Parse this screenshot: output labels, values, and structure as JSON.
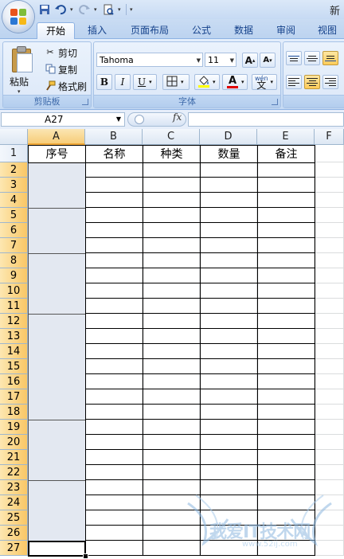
{
  "title_text": "新",
  "ribbon_tabs": [
    "开始",
    "插入",
    "页面布局",
    "公式",
    "数据",
    "审阅",
    "视图"
  ],
  "clipboard": {
    "paste": "粘贴",
    "cut": "剪切",
    "copy": "复制",
    "format_painter": "格式刷",
    "group_label": "剪贴板"
  },
  "font": {
    "name": "Tahoma",
    "size": "11",
    "group_label": "字体",
    "grow": "A",
    "shrink": "A",
    "bold": "B",
    "italic": "I",
    "underline": "U",
    "color_letter": "A",
    "phonetic_char": "文",
    "phonetic_top": "wén"
  },
  "formula_bar": {
    "cell_ref": "A27",
    "fx": "fx",
    "value": ""
  },
  "colors": {
    "font_color": "#e00000",
    "fill_color": "#ffff00",
    "selection": "#f9c766"
  },
  "columns": [
    "A",
    "B",
    "C",
    "D",
    "E",
    "F"
  ],
  "selected_column": "A",
  "rows": [
    "1",
    "2",
    "3",
    "4",
    "5",
    "6",
    "7",
    "8",
    "9",
    "10",
    "11",
    "12",
    "13",
    "14",
    "15",
    "16",
    "17",
    "18",
    "19",
    "20",
    "21",
    "22",
    "23",
    "24",
    "25",
    "26",
    "27"
  ],
  "header_row": [
    "序号",
    "名称",
    "种类",
    "数量",
    "备注"
  ],
  "watermark": {
    "text": "我爱IT技术网",
    "sub": "www.52ij.com"
  }
}
